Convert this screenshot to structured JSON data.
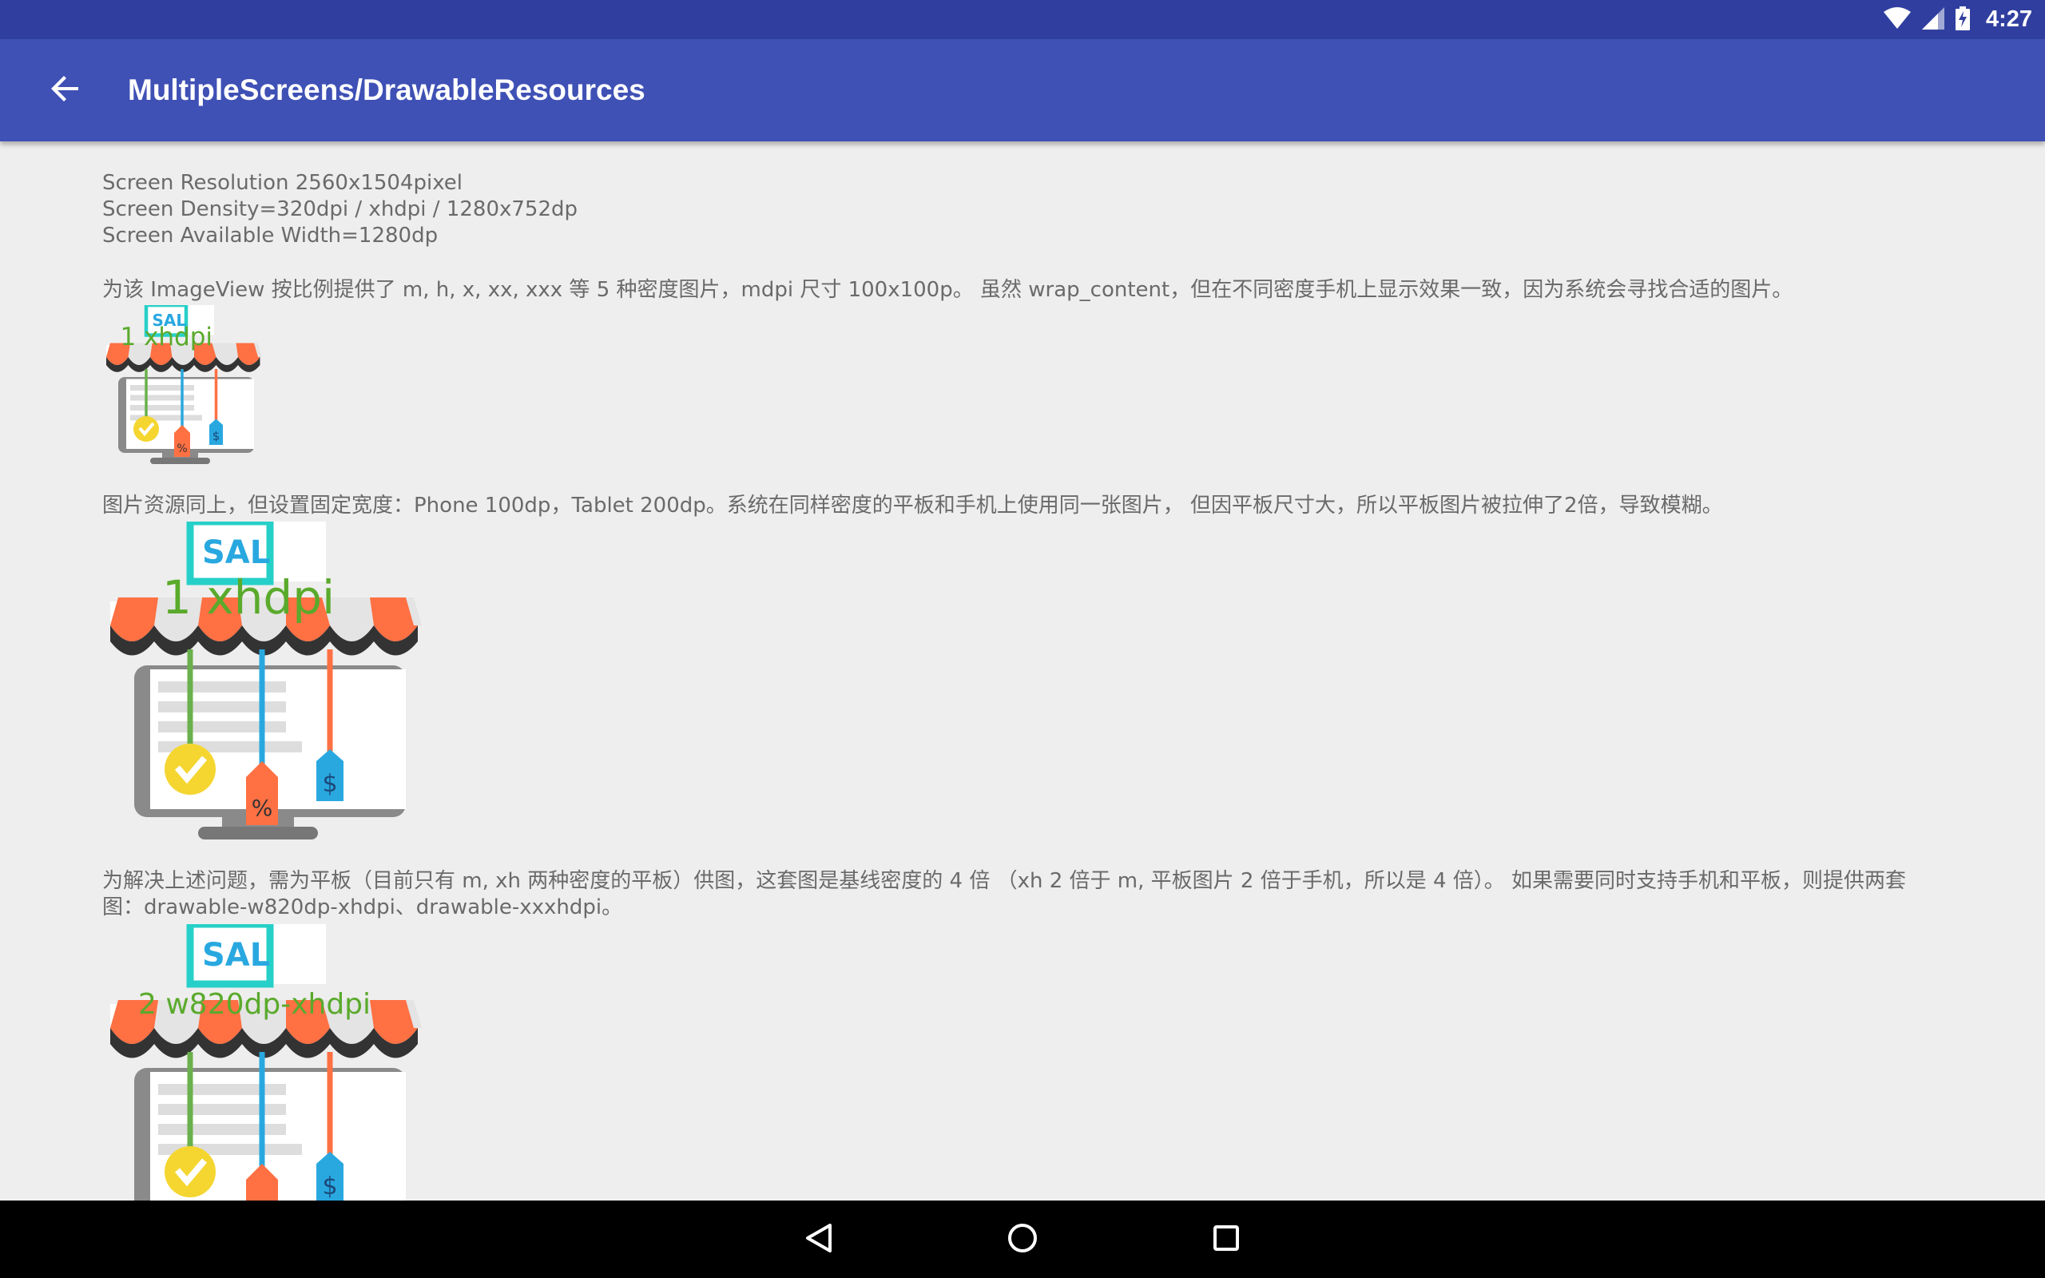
{
  "status_bar": {
    "time": "4:27",
    "icons": [
      "wifi-icon",
      "cell-signal-icon",
      "battery-charging-icon"
    ],
    "background": "#303f9f"
  },
  "app_bar": {
    "title": "MultipleScreens/DrawableResources",
    "back_icon": "arrow-back-icon",
    "background": "#3f51b5"
  },
  "content": {
    "screen_info": [
      "Screen Resolution 2560x1504pixel",
      "Screen Density=320dpi / xhdpi / 1280x752dp",
      "Screen Available Width=1280dp"
    ],
    "paragraph1": "为该 ImageView 按比例提供了 m, h, x, xx, xxx 等 5 种密度图片，mdpi 尺寸 100x100p。 虽然 wrap_content，但在不同密度手机上显示效果一致，因为系统会寻找合适的图片。",
    "image1": {
      "sale": "SAL",
      "caption": "1 xhdpi"
    },
    "paragraph2": "图片资源同上，但设置固定宽度：Phone 100dp，Tablet 200dp。系统在同样密度的平板和手机上使用同一张图片， 但因平板尺寸大，所以平板图片被拉伸了2倍，导致模糊。",
    "image2": {
      "sale": "SAL",
      "caption": "1 xhdpi"
    },
    "paragraph3": "为解决上述问题，需为平板（目前只有 m, xh 两种密度的平板）供图，这套图是基线密度的 4 倍 （xh 2 倍于 m, 平板图片 2 倍于手机，所以是 4 倍）。 如果需要同时支持手机和平板，则提供两套图：drawable-w820dp-xhdpi、drawable-xxxhdpi。",
    "image3": {
      "sale": "SAL",
      "caption": "2  w820dp-xhdpi"
    }
  },
  "nav_bar": {
    "buttons": [
      "back-triangle-icon",
      "home-circle-icon",
      "recents-square-icon"
    ]
  },
  "colors": {
    "awning_orange": "#ff7043",
    "awning_gray": "#e0e0e0",
    "caption_green": "#5aaa2c",
    "sale_teal": "#26d0c8",
    "sale_blue": "#29a8e0",
    "text_gray": "#6a6a6a"
  }
}
